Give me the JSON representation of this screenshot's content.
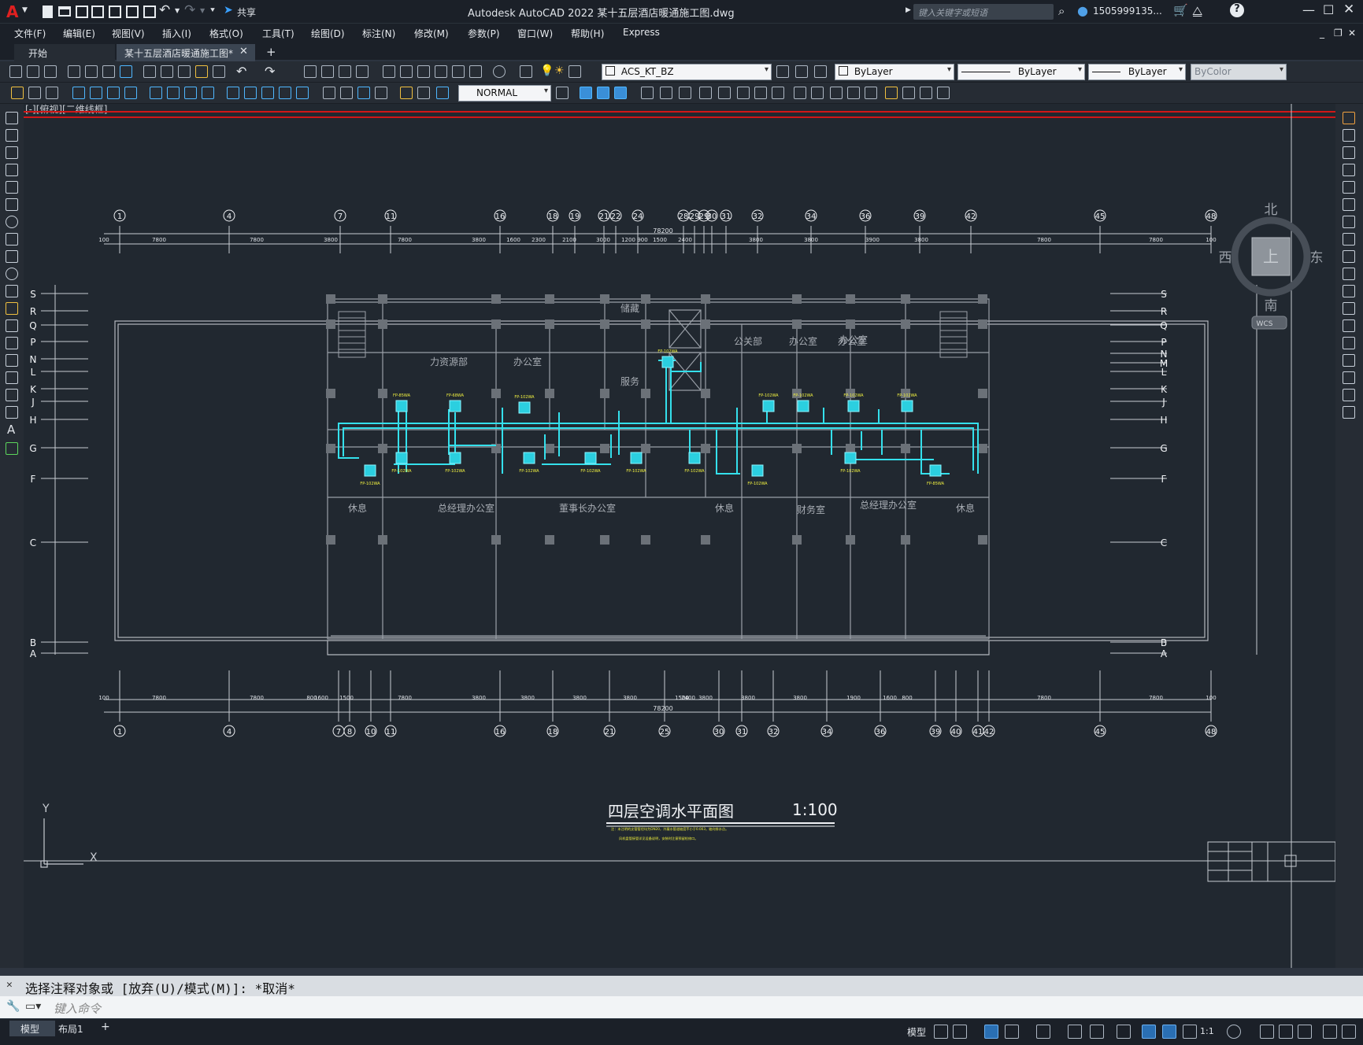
{
  "app": {
    "logo": "A",
    "window_title": "Autodesk AutoCAD 2022    某十五层酒店暖通施工图.dwg",
    "share_label": "共享",
    "search_placeholder": "键入关键字或短语",
    "user": "1505999135...",
    "cart_icon": "cart-icon",
    "help_label": "?"
  },
  "menu": [
    "文件(F)",
    "编辑(E)",
    "视图(V)",
    "插入(I)",
    "格式(O)",
    "工具(T)",
    "绘图(D)",
    "标注(N)",
    "修改(M)",
    "参数(P)",
    "窗口(W)",
    "帮助(H)",
    "Express"
  ],
  "tabs": {
    "start": "开始",
    "active": "某十五层酒店暖通施工图*",
    "new": "+"
  },
  "toolbar": {
    "layer": "ACS_KT_BZ",
    "color": "ByLayer",
    "linetype": "ByLayer",
    "lineweight": "ByLayer",
    "plotstyle": "ByColor",
    "style": "NORMAL"
  },
  "viewport": {
    "label": "[-][俯视][二维线框]",
    "viewcube": {
      "north": "北",
      "south": "南",
      "east": "东",
      "west": "西",
      "top": "上",
      "wcs": "WCS"
    },
    "ucs": {
      "x": "X",
      "y": "Y"
    }
  },
  "drawing": {
    "title": "四层空调水平面图",
    "scale": "1:100",
    "total_dim": "78200",
    "note1": "注：未注明的支管管径均为DN20，冷凝水管道坡度不小于0.003，坡向排水点。",
    "note2": "风机盘管接管详见设备说明，安装时注意预留检修口。",
    "top_axes": [
      "1",
      "4",
      "7",
      "11",
      "16",
      "18",
      "19",
      "21",
      "22",
      "24",
      "28",
      "29",
      "29",
      "30",
      "31",
      "32",
      "34",
      "36",
      "39",
      "42",
      "45",
      "48"
    ],
    "bottom_axes": [
      "1",
      "4",
      "7",
      "8",
      "10",
      "11",
      "16",
      "18",
      "21",
      "25",
      "30",
      "31",
      "32",
      "34",
      "36",
      "39",
      "40",
      "41",
      "42",
      "45",
      "48"
    ],
    "top_dims": [
      "100",
      "7800",
      "7800",
      "3800",
      "7800",
      "3800",
      "1600",
      "2300",
      "2100",
      "3000",
      "1200",
      "900",
      "1500",
      "2400",
      "3800",
      "3800",
      "3900",
      "3800",
      "7800",
      "7800",
      "100"
    ],
    "bottom_dims": [
      "100",
      "7800",
      "7800",
      "800",
      "1600",
      "1500",
      "7800",
      "3800",
      "3800",
      "3800",
      "3800",
      "1500",
      "2400",
      "3800",
      "3800",
      "3800",
      "1900",
      "1600",
      "800",
      "7800",
      "7800",
      "100"
    ],
    "row_axes": [
      "S",
      "R",
      "Q",
      "P",
      "N",
      "L",
      "K",
      "J",
      "H",
      "G",
      "F",
      "C",
      "B",
      "A"
    ],
    "right_row_axes": [
      "S",
      "R",
      "Q",
      "P",
      "N",
      "M",
      "L",
      "K",
      "J",
      "H",
      "G",
      "F",
      "C",
      "B",
      "A"
    ],
    "rooms": [
      "力资源部",
      "办公室",
      "储藏",
      "公关部",
      "办公室",
      "办公室",
      "办公室",
      "服务",
      "休息",
      "总经理办公室",
      "董事长办公室",
      "休息",
      "财务室",
      "总经理办公室",
      "休息"
    ],
    "fcu_labels": [
      "FP-85WA",
      "FP-68WA",
      "FP-102WA",
      "FP-102WA",
      "FP-102WA",
      "FP-102WA",
      "FP-102WA",
      "FP-102WA",
      "FP-102WA",
      "FP-102WA",
      "FP-102WA",
      "FP-102WA",
      "FP-102WA",
      "FP-102WA",
      "FP-102WA",
      "FP-102WA",
      "FP-102WA",
      "FP-85WA"
    ]
  },
  "command": {
    "history": "选择注释对象或 [放弃(U)/模式(M)]: *取消*",
    "placeholder": "键入命令"
  },
  "status": {
    "model_tab": "模型",
    "layout_tab": "布局1",
    "add": "+",
    "model_btn": "模型",
    "scale": "1:1"
  }
}
